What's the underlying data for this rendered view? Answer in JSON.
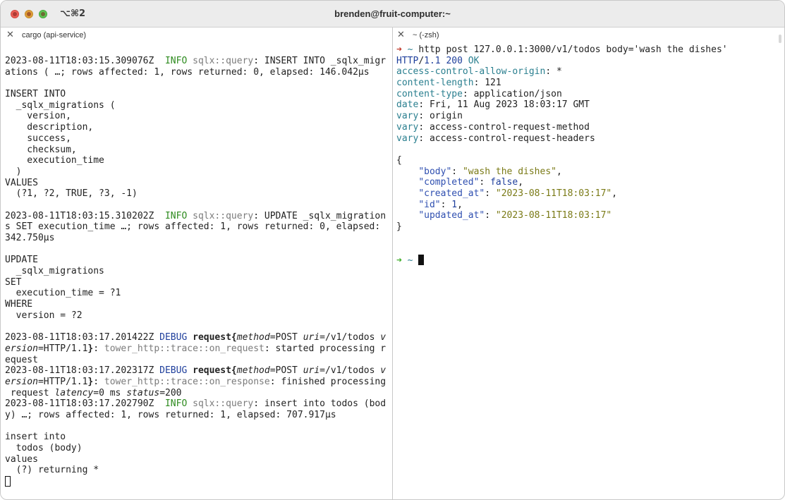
{
  "window": {
    "title": "brenden@fruit-computer:~",
    "shortcut": "⌥⌘2"
  },
  "left_pane": {
    "tab_title": "cargo (api-service)",
    "lines": [
      [
        {
          "t": "2023-08-11T18:03:15.309076Z  "
        },
        {
          "t": "INFO",
          "c": "c-info"
        },
        {
          "t": " "
        },
        {
          "t": "sqlx::query",
          "c": "c-dim"
        },
        {
          "t": ": INSERT INTO _sqlx_migr"
        }
      ],
      [
        {
          "t": "ations ( …; rows affected: 1, rows returned: 0, elapsed: 146.042µs"
        }
      ],
      [],
      [
        {
          "t": "INSERT INTO"
        }
      ],
      [
        {
          "t": "  _sqlx_migrations ("
        }
      ],
      [
        {
          "t": "    version,"
        }
      ],
      [
        {
          "t": "    description,"
        }
      ],
      [
        {
          "t": "    success,"
        }
      ],
      [
        {
          "t": "    checksum,"
        }
      ],
      [
        {
          "t": "    execution_time"
        }
      ],
      [
        {
          "t": "  )"
        }
      ],
      [
        {
          "t": "VALUES"
        }
      ],
      [
        {
          "t": "  (?1, ?2, TRUE, ?3, -1)"
        }
      ],
      [],
      [
        {
          "t": "2023-08-11T18:03:15.310202Z  "
        },
        {
          "t": "INFO",
          "c": "c-info"
        },
        {
          "t": " "
        },
        {
          "t": "sqlx::query",
          "c": "c-dim"
        },
        {
          "t": ": UPDATE _sqlx_migration"
        }
      ],
      [
        {
          "t": "s SET execution_time …; rows affected: 1, rows returned: 0, elapsed:"
        }
      ],
      [
        {
          "t": "342.750µs"
        }
      ],
      [],
      [
        {
          "t": "UPDATE"
        }
      ],
      [
        {
          "t": "  _sqlx_migrations"
        }
      ],
      [
        {
          "t": "SET"
        }
      ],
      [
        {
          "t": "  execution_time = ?1"
        }
      ],
      [
        {
          "t": "WHERE"
        }
      ],
      [
        {
          "t": "  version = ?2"
        }
      ],
      [],
      [
        {
          "t": "2023-08-11T18:03:17.201422Z "
        },
        {
          "t": "DEBUG",
          "c": "c-debug"
        },
        {
          "t": " "
        },
        {
          "t": "request{",
          "c": "c-bold"
        },
        {
          "t": "method",
          "c": "c-it"
        },
        {
          "t": "=POST "
        },
        {
          "t": "uri",
          "c": "c-it"
        },
        {
          "t": "=/v1/todos "
        },
        {
          "t": "v",
          "c": "c-it"
        }
      ],
      [
        {
          "t": "ersion",
          "c": "c-it"
        },
        {
          "t": "=HTTP/1.1"
        },
        {
          "t": "}",
          "c": "c-bold"
        },
        {
          "t": ": "
        },
        {
          "t": "tower_http::trace::on_request",
          "c": "c-dim"
        },
        {
          "t": ": started processing r"
        }
      ],
      [
        {
          "t": "equest"
        }
      ],
      [
        {
          "t": "2023-08-11T18:03:17.202317Z "
        },
        {
          "t": "DEBUG",
          "c": "c-debug"
        },
        {
          "t": " "
        },
        {
          "t": "request{",
          "c": "c-bold"
        },
        {
          "t": "method",
          "c": "c-it"
        },
        {
          "t": "=POST "
        },
        {
          "t": "uri",
          "c": "c-it"
        },
        {
          "t": "=/v1/todos "
        },
        {
          "t": "v",
          "c": "c-it"
        }
      ],
      [
        {
          "t": "ersion",
          "c": "c-it"
        },
        {
          "t": "=HTTP/1.1"
        },
        {
          "t": "}",
          "c": "c-bold"
        },
        {
          "t": ": "
        },
        {
          "t": "tower_http::trace::on_response",
          "c": "c-dim"
        },
        {
          "t": ": finished processing"
        }
      ],
      [
        {
          "t": " request "
        },
        {
          "t": "latency",
          "c": "c-it"
        },
        {
          "t": "=0 ms "
        },
        {
          "t": "status",
          "c": "c-it"
        },
        {
          "t": "=200"
        }
      ],
      [
        {
          "t": "2023-08-11T18:03:17.202790Z  "
        },
        {
          "t": "INFO",
          "c": "c-info"
        },
        {
          "t": " "
        },
        {
          "t": "sqlx::query",
          "c": "c-dim"
        },
        {
          "t": ": insert into todos (bod"
        }
      ],
      [
        {
          "t": "y) …; rows affected: 1, rows returned: 1, elapsed: 707.917µs"
        }
      ],
      [],
      [
        {
          "t": "insert into"
        }
      ],
      [
        {
          "t": "  todos (body)"
        }
      ],
      [
        {
          "t": "values"
        }
      ],
      [
        {
          "t": "  (?) returning *"
        }
      ],
      []
    ]
  },
  "right_pane": {
    "tab_title": "~ (-zsh)",
    "lines": [
      [
        {
          "t": "➜ ",
          "c": "c-red"
        },
        {
          "t": "~ ",
          "c": "c-teal"
        },
        {
          "t": "http post 127.0.0.1:3000/v1/todos body='wash the dishes'"
        }
      ],
      [
        {
          "t": "HTTP",
          "c": "c-blue"
        },
        {
          "t": "/"
        },
        {
          "t": "1.1 200",
          "c": "c-blue"
        },
        {
          "t": " "
        },
        {
          "t": "OK",
          "c": "c-teal"
        }
      ],
      [
        {
          "t": "access-control-allow-origin",
          "c": "c-teal"
        },
        {
          "t": ": *"
        }
      ],
      [
        {
          "t": "content-length",
          "c": "c-teal"
        },
        {
          "t": ": 121"
        }
      ],
      [
        {
          "t": "content-type",
          "c": "c-teal"
        },
        {
          "t": ": application/json"
        }
      ],
      [
        {
          "t": "date",
          "c": "c-teal"
        },
        {
          "t": ": Fri, 11 Aug 2023 18:03:17 GMT"
        }
      ],
      [
        {
          "t": "vary",
          "c": "c-teal"
        },
        {
          "t": ": origin"
        }
      ],
      [
        {
          "t": "vary",
          "c": "c-teal"
        },
        {
          "t": ": access-control-request-method"
        }
      ],
      [
        {
          "t": "vary",
          "c": "c-teal"
        },
        {
          "t": ": access-control-request-headers"
        }
      ],
      [],
      [
        {
          "t": "{"
        }
      ],
      [
        {
          "t": "    "
        },
        {
          "t": "\"body\"",
          "c": "c-key"
        },
        {
          "t": ": "
        },
        {
          "t": "\"wash the dishes\"",
          "c": "c-str"
        },
        {
          "t": ","
        }
      ],
      [
        {
          "t": "    "
        },
        {
          "t": "\"completed\"",
          "c": "c-key"
        },
        {
          "t": ": "
        },
        {
          "t": "false",
          "c": "c-blue"
        },
        {
          "t": ","
        }
      ],
      [
        {
          "t": "    "
        },
        {
          "t": "\"created_at\"",
          "c": "c-key"
        },
        {
          "t": ": "
        },
        {
          "t": "\"2023-08-11T18:03:17\"",
          "c": "c-str"
        },
        {
          "t": ","
        }
      ],
      [
        {
          "t": "    "
        },
        {
          "t": "\"id\"",
          "c": "c-key"
        },
        {
          "t": ": "
        },
        {
          "t": "1",
          "c": "c-blue"
        },
        {
          "t": ","
        }
      ],
      [
        {
          "t": "    "
        },
        {
          "t": "\"updated_at\"",
          "c": "c-key"
        },
        {
          "t": ": "
        },
        {
          "t": "\"2023-08-11T18:03:17\"",
          "c": "c-str"
        }
      ],
      [
        {
          "t": "}"
        }
      ],
      [],
      [],
      [
        {
          "t": "➜ ",
          "c": "c-green"
        },
        {
          "t": "~ ",
          "c": "c-teal"
        }
      ]
    ]
  },
  "colors": {
    "titlebar": "#ececec",
    "close_light": "#ec5f57",
    "minimize_light": "#e0a03a",
    "zoom_light": "#5fc454",
    "prompt_arrow_error": "#c0392b",
    "prompt_arrow_ok": "#3fae2a"
  }
}
